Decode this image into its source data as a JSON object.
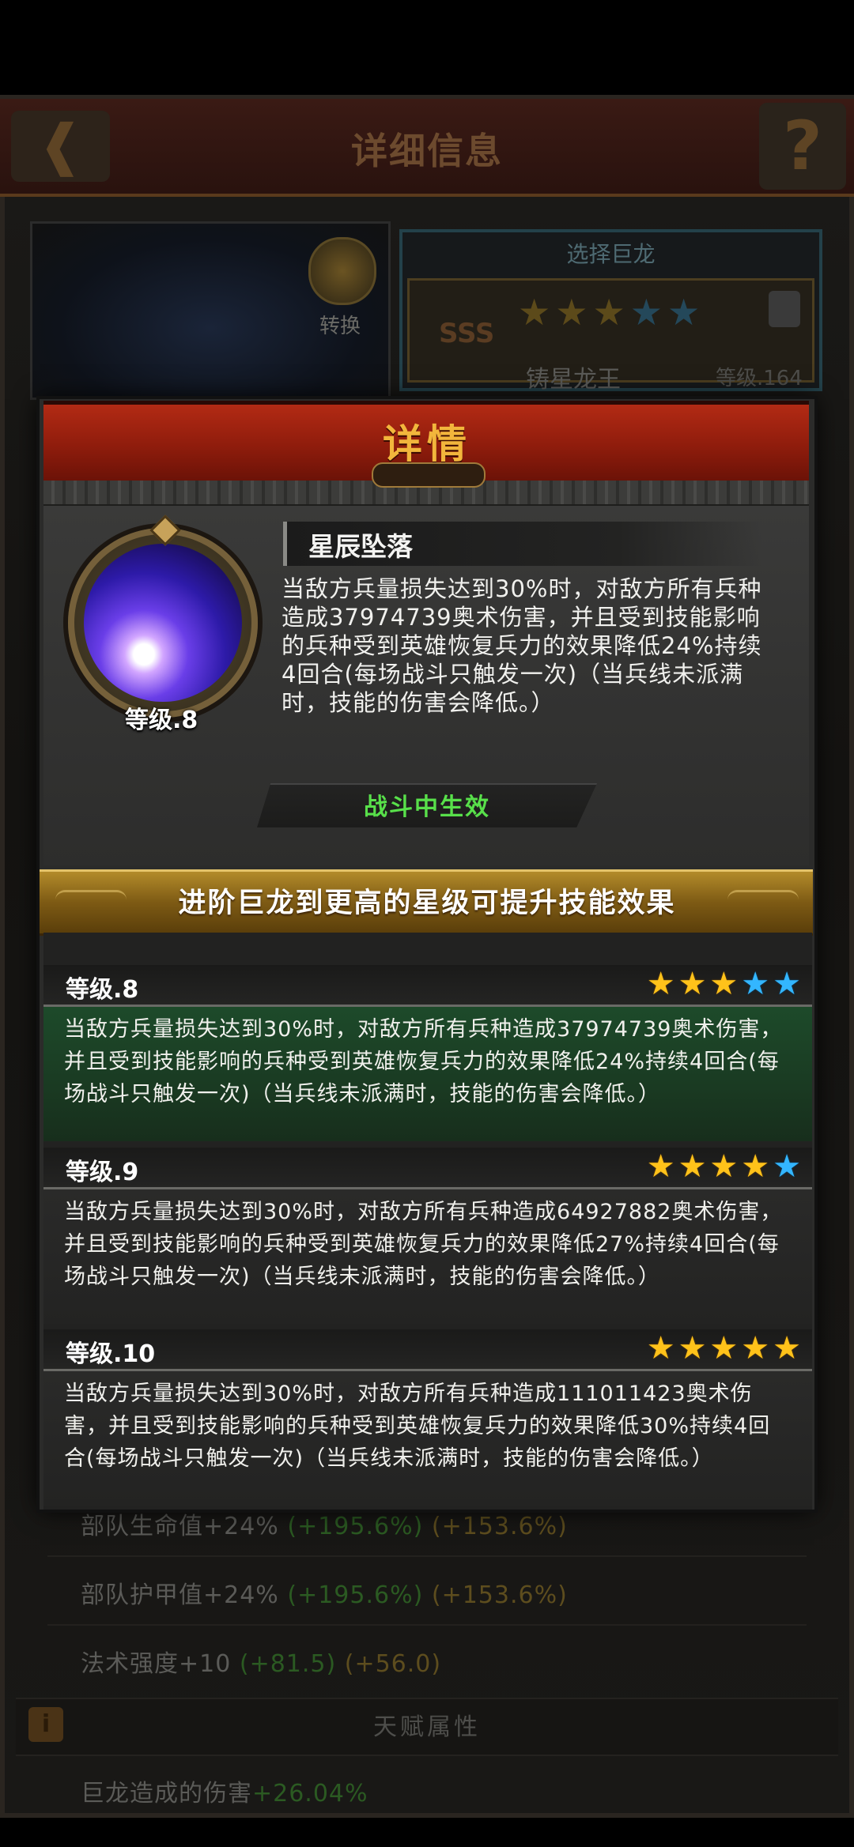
{
  "background": {
    "title": "详细信息",
    "back_icon": "back-arrow-icon",
    "help_label": "?",
    "convert_label": "转换",
    "select_dragon_header": "选择巨龙",
    "dragon_rank": "SSS",
    "dragon_name": "铸星龙王",
    "dragon_level": "等级.164",
    "dragon_stars": {
      "gold": 3,
      "blue": 2
    },
    "stats": [
      {
        "label": "部队生命值+24%",
        "bonus1": "(+195.6%)",
        "bonus2": "(+153.6%)"
      },
      {
        "label": "部队护甲值+24%",
        "bonus1": "(+195.6%)",
        "bonus2": "(+153.6%)"
      },
      {
        "label": "法术强度+10",
        "bonus1": "(+81.5)",
        "bonus2": "(+56.0)"
      }
    ],
    "talent_label": "天赋属性",
    "damage_stat": {
      "label": "巨龙造成的伤害",
      "bonus": "+26.04%"
    }
  },
  "modal": {
    "title": "详情",
    "skill": {
      "name": "星辰坠落",
      "level": "等级.8",
      "description": "当敌方兵量损失达到30%时，对敌方所有兵种造成37974739奥术伤害，并且受到技能影响的兵种受到英雄恢复兵力的效果降低24%持续4回合(每场战斗只触发一次)（当兵线未派满时，技能的伤害会降低。）",
      "effect_label": "战斗中生效"
    },
    "upgrade_banner": "进阶巨龙到更高的星级可提升技能效果",
    "levels": [
      {
        "title": "等级.8",
        "stars": {
          "gold": 3,
          "blue": 2
        },
        "text": "当敌方兵量损失达到30%时，对敌方所有兵种造成37974739奥术伤害，并且受到技能影响的兵种受到英雄恢复兵力的效果降低24%持续4回合(每场战斗只触发一次)（当兵线未派满时，技能的伤害会降低。）"
      },
      {
        "title": "等级.9",
        "stars": {
          "gold": 4,
          "blue": 1
        },
        "text": "当敌方兵量损失达到30%时，对敌方所有兵种造成64927882奥术伤害，并且受到技能影响的兵种受到英雄恢复兵力的效果降低27%持续4回合(每场战斗只触发一次)（当兵线未派满时，技能的伤害会降低。）"
      },
      {
        "title": "等级.10",
        "stars": {
          "gold": 5,
          "blue": 0
        },
        "text": "当敌方兵量损失达到30%时，对敌方所有兵种造成111011423奥术伤害，并且受到技能影响的兵种受到英雄恢复兵力的效果降低30%持续4回合(每场战斗只触发一次)（当兵线未派满时，技能的伤害会降低。）"
      }
    ]
  },
  "colors": {
    "gold_star": "#ffc21a",
    "blue_star": "#33b6ff",
    "effect_green": "#58e04a",
    "header_red": "#b22a14"
  }
}
